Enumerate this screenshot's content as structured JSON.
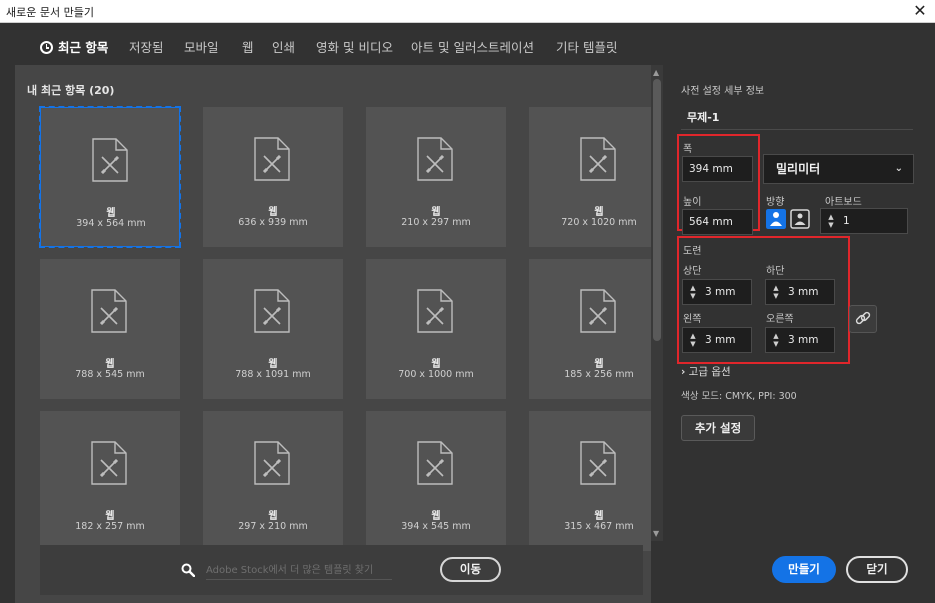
{
  "window": {
    "title": "새로운 문서 만들기",
    "close_glyph": "✕"
  },
  "tabs": [
    {
      "label": "최근 항목",
      "active": true
    },
    {
      "label": "저장됨"
    },
    {
      "label": "모바일"
    },
    {
      "label": "웹"
    },
    {
      "label": "인쇄"
    },
    {
      "label": "영화 및 비디오"
    },
    {
      "label": "아트 및 일러스트레이션"
    },
    {
      "label": "기타 템플릿"
    }
  ],
  "recent": {
    "title": "내 최근 항목  (20)",
    "items": [
      {
        "type": "웹",
        "size": "394 x 564 mm",
        "selected": true
      },
      {
        "type": "웹",
        "size": "636 x 939 mm"
      },
      {
        "type": "웹",
        "size": "210 x 297 mm"
      },
      {
        "type": "웹",
        "size": "720 x 1020 mm"
      },
      {
        "type": "웹",
        "size": "788 x 545 mm"
      },
      {
        "type": "웹",
        "size": "788 x 1091 mm"
      },
      {
        "type": "웹",
        "size": "700 x 1000 mm"
      },
      {
        "type": "웹",
        "size": "185 x 256 mm"
      },
      {
        "type": "웹",
        "size": "182 x 257 mm"
      },
      {
        "type": "웹",
        "size": "297 x 210 mm"
      },
      {
        "type": "웹",
        "size": "394 x 545 mm"
      },
      {
        "type": "웹",
        "size": "315 x 467 mm"
      }
    ]
  },
  "search": {
    "placeholder": "Adobe Stock에서 더 많은 템플릿 찾기",
    "go_label": "이동"
  },
  "preset": {
    "section_title": "사전 설정 세부 정보",
    "name": "무제-1",
    "width_label": "폭",
    "width_value": "394 mm",
    "unit": "밀리미터",
    "height_label": "높이",
    "height_value": "564 mm",
    "orientation_label": "방향",
    "artboard_label": "아트보드",
    "artboard_value": "1",
    "bleed_label": "도련",
    "top_label": "상단",
    "top_value": "3 mm",
    "bottom_label": "하단",
    "bottom_value": "3 mm",
    "left_label": "왼쪽",
    "left_value": "3 mm",
    "right_label": "오른쪽",
    "right_value": "3 mm",
    "advanced_label": "고급 옵션",
    "color_mode": "색상 모드: CMYK, PPI: 300",
    "more_settings_label": "추가 설정"
  },
  "actions": {
    "create_label": "만들기",
    "close_label": "닫기"
  },
  "colors": {
    "accent": "#1473e6",
    "highlight": "#e0262b",
    "panel": "#464646",
    "card": "#535353"
  }
}
